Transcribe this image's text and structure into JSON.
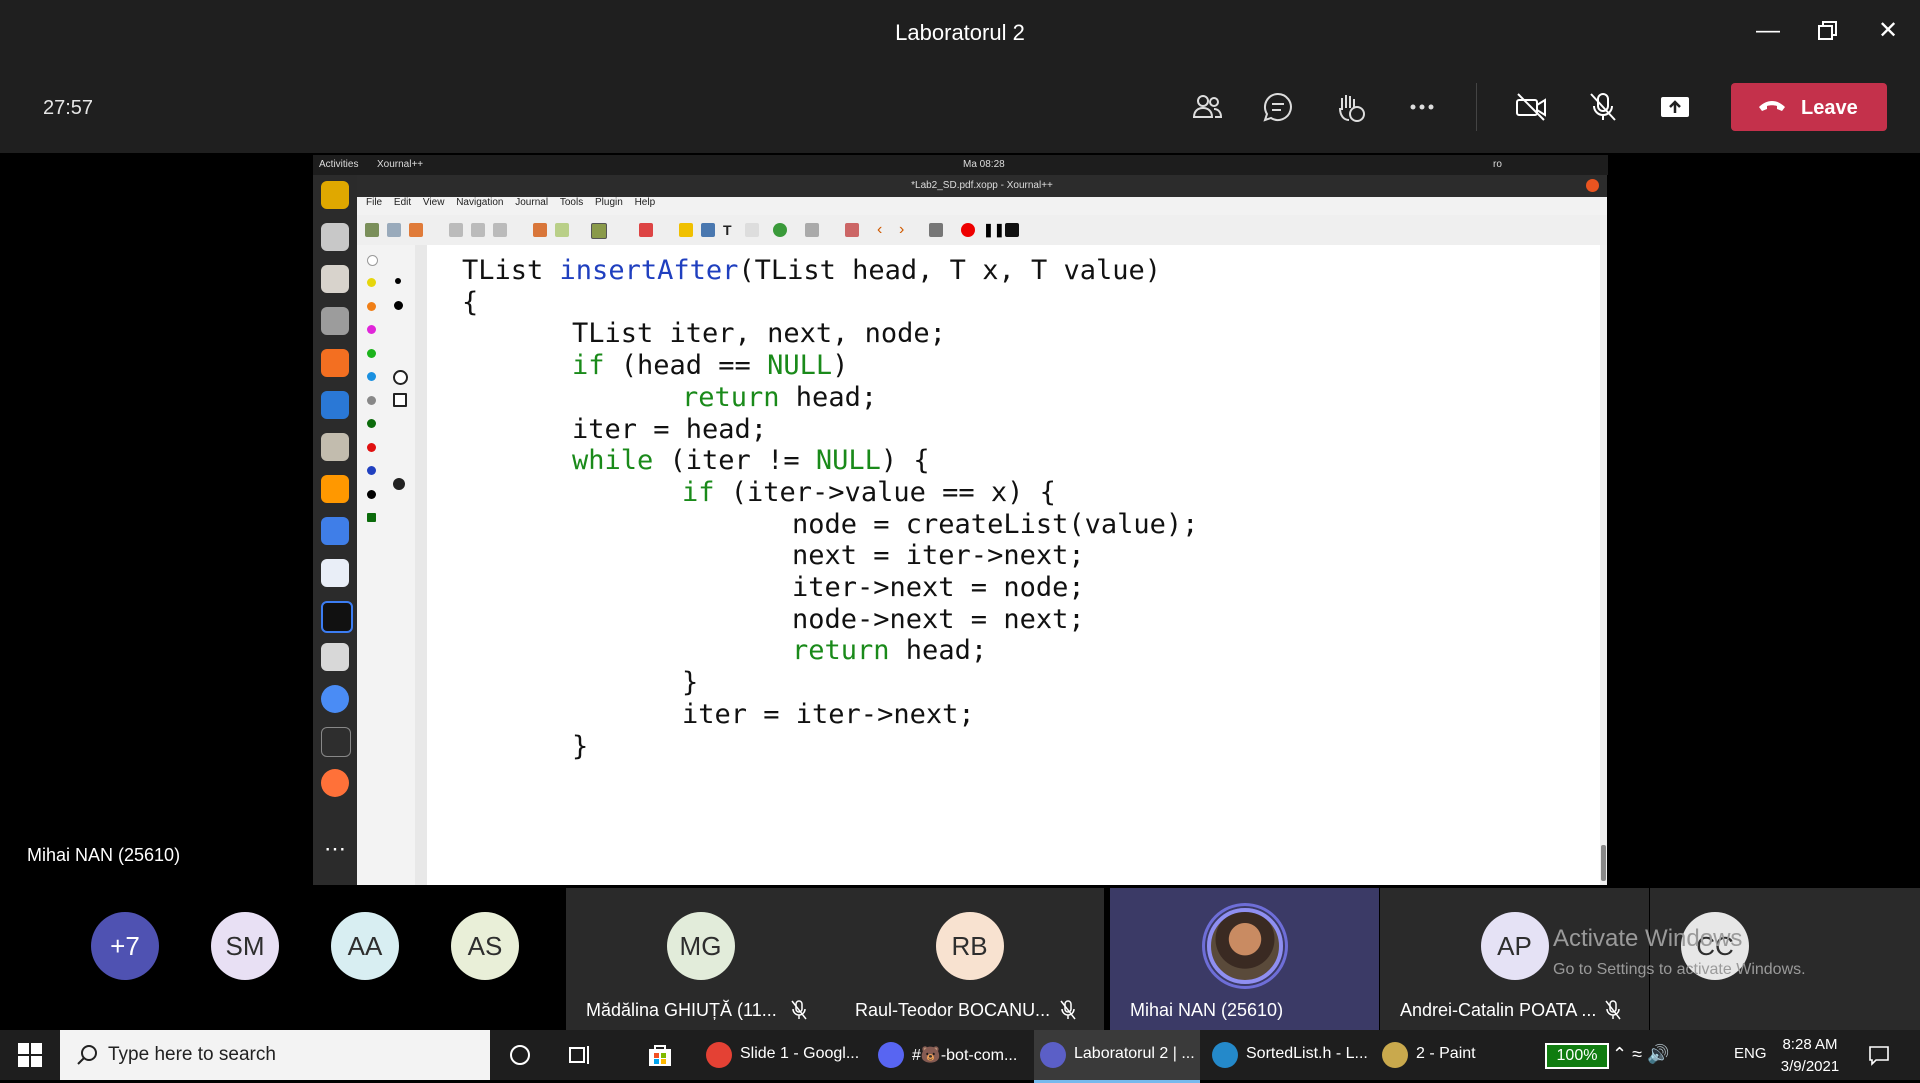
{
  "window": {
    "title": "Laboratorul 2"
  },
  "meeting": {
    "timer": "27:57",
    "leave_label": "Leave",
    "presenter_name": "Mihai NAN (25610)"
  },
  "ubuntu": {
    "activities": "Activities",
    "app": "Xournal++",
    "clock": "Ma 08:28",
    "lang": "ro",
    "window_title": "*Lab2_SD.pdf.xopp - Xournal++",
    "menu": [
      "File",
      "Edit",
      "View",
      "Navigation",
      "Journal",
      "Tools",
      "Plugin",
      "Help"
    ]
  },
  "code_lines": [
    {
      "indent": 0,
      "parts": [
        [
          "",
          "TList "
        ],
        [
          "fn",
          "insertAfter"
        ],
        [
          "",
          "(TList head, T x, T value)"
        ]
      ]
    },
    {
      "indent": 0,
      "parts": [
        [
          "",
          "{"
        ]
      ]
    },
    {
      "indent": 1,
      "parts": [
        [
          "",
          "TList iter, next, node;"
        ]
      ]
    },
    {
      "indent": 1,
      "parts": [
        [
          "kw",
          "if"
        ],
        [
          "",
          " (head == "
        ],
        [
          "kw",
          "NULL"
        ],
        [
          "",
          ")"
        ]
      ]
    },
    {
      "indent": 2,
      "parts": [
        [
          "kw",
          "return"
        ],
        [
          "",
          " head;"
        ]
      ]
    },
    {
      "indent": 1,
      "parts": [
        [
          "",
          "iter = head;"
        ]
      ]
    },
    {
      "indent": 1,
      "parts": [
        [
          "kw",
          "while"
        ],
        [
          "",
          " (iter != "
        ],
        [
          "kw",
          "NULL"
        ],
        [
          "",
          ") {"
        ]
      ]
    },
    {
      "indent": 2,
      "parts": [
        [
          "kw",
          "if"
        ],
        [
          "",
          " (iter->value == x) {"
        ]
      ]
    },
    {
      "indent": 3,
      "parts": [
        [
          "",
          "node = createList(value);"
        ]
      ]
    },
    {
      "indent": 3,
      "parts": [
        [
          "",
          "next = iter->next;"
        ]
      ]
    },
    {
      "indent": 3,
      "parts": [
        [
          "",
          "iter->next = node;"
        ]
      ]
    },
    {
      "indent": 3,
      "parts": [
        [
          "",
          "node->next = next;"
        ]
      ]
    },
    {
      "indent": 3,
      "parts": [
        [
          "kw",
          "return"
        ],
        [
          "",
          " head;"
        ]
      ]
    },
    {
      "indent": 2,
      "parts": [
        [
          "",
          "}"
        ]
      ]
    },
    {
      "indent": 2,
      "parts": [
        [
          "",
          "iter = iter->next;"
        ]
      ]
    },
    {
      "indent": 1,
      "parts": [
        [
          "",
          "}"
        ]
      ]
    }
  ],
  "participants": [
    {
      "initials": "+7",
      "color": "#4f52b2",
      "text_color": "#ffffff"
    },
    {
      "initials": "SM",
      "color": "#e8e0f4"
    },
    {
      "initials": "AA",
      "color": "#d8eef2"
    },
    {
      "initials": "AS",
      "color": "#e9efd8"
    },
    {
      "initials": "MG",
      "name": "Mădălina GHIUȚĂ (11...",
      "color": "#e2ecda",
      "muted": true
    },
    {
      "initials": "RB",
      "name": "Raul-Teodor BOCANU...",
      "color": "#f8e2d0",
      "muted": true
    },
    {
      "name": "Mihai NAN (25610)",
      "speaking": true
    },
    {
      "initials": "AP",
      "name": "Andrei-Catalin POATA ...",
      "color": "#e5e2f5",
      "muted": true
    },
    {
      "initials": "CC",
      "color": "#e7e7e7"
    }
  ],
  "watermark": {
    "line1": "Activate Windows",
    "line2": "Go to Settings to activate Windows."
  },
  "taskbar": {
    "search_placeholder": "Type here to search",
    "items": [
      {
        "label": "Slide 1 - Googl...",
        "icon": "chrome-icon",
        "color": "#e44134"
      },
      {
        "label": "#🐻-bot-com...",
        "icon": "discord-icon",
        "color": "#5865f2"
      },
      {
        "label": "Laboratorul 2 | ...",
        "icon": "teams-icon",
        "color": "#5b5fc7"
      },
      {
        "label": "SortedList.h - L...",
        "icon": "vscode-icon",
        "color": "#2489ca"
      },
      {
        "label": "2 - Paint",
        "icon": "paint-icon",
        "color": "#c9a94d"
      }
    ],
    "battery": "100%",
    "lang": "ENG",
    "time": "8:28 AM",
    "date": "3/9/2021"
  }
}
